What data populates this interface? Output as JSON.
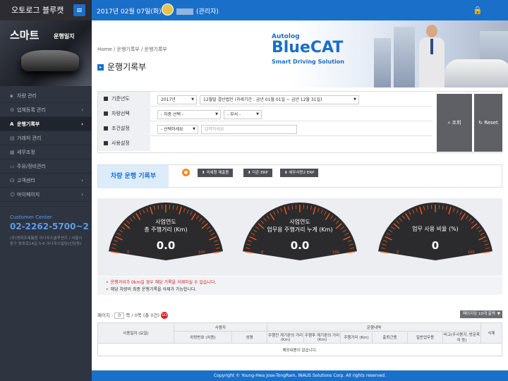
{
  "header": {
    "app_title": "오토로그 블루캣",
    "date": "2017년 02월 07일(화)",
    "user_role": "(관리자)"
  },
  "sidebar": {
    "promo_title": "스마트",
    "promo_subtitle": "운행일지",
    "items": [
      {
        "label": "차량 관리",
        "icon": "car-icon",
        "active": false,
        "chevron": ""
      },
      {
        "label": "업체등록 관리",
        "icon": "gear-icon",
        "active": false,
        "chevron": "›"
      },
      {
        "label": "운행기록부",
        "icon": "a-icon",
        "active": true,
        "chevron": "›"
      },
      {
        "label": "거래처 관리",
        "icon": "document-icon",
        "active": false,
        "chevron": ""
      },
      {
        "label": "세무조정",
        "icon": "calculator-icon",
        "active": false,
        "chevron": ""
      },
      {
        "label": "주유/정비관리",
        "icon": "wallet-icon",
        "active": false,
        "chevron": ""
      },
      {
        "label": "고객센터",
        "icon": "headset-icon",
        "active": false,
        "chevron": "›"
      },
      {
        "label": "마이페이지",
        "icon": "person-icon",
        "active": false,
        "chevron": "›"
      }
    ],
    "customer_center_label": "Customer Center",
    "customer_center_phone": "02-2262-5700~2",
    "address": "(주)영화조세통람 이나우스솔루션즈 / 서울시 중구 동호로14길 5-6 이나우스빌딩(신당동)"
  },
  "breadcrumb": {
    "home": "Home",
    "level1": "운행기록부",
    "level2": "운행기록부",
    "sep": "/"
  },
  "page_title": "운행기록부",
  "banner": {
    "logo_top": "Autolog",
    "logo_main": "BlueCAT",
    "logo_sub": "Smart Driving Solution"
  },
  "filter": {
    "rows": [
      {
        "label": "기준년도"
      },
      {
        "label": "차량선택"
      },
      {
        "label": "조건설정"
      },
      {
        "label": "사용설정"
      }
    ],
    "year": "2017년",
    "period": "12월말 결산법인 (과세기간 : 금년 01월 01일 ~ 금년 12월 31일)",
    "vehicle_select": "- 차종 선택 -",
    "dept_select": "- 부서 -",
    "condition_select": "- 선택하세요",
    "condition_placeholder": "입력하세요",
    "search_label": "조회",
    "reset_label": "Reset"
  },
  "section": {
    "title": "차량 운행 기록부",
    "buttons": [
      {
        "label": "국세청 제출용"
      },
      {
        "label": "더존 ERP"
      },
      {
        "label": "세무사랑2 ERP"
      }
    ]
  },
  "gauges": [
    {
      "line1": "사업연도",
      "line2": "총 주행거리 (Km)",
      "value": "0.0",
      "min": "0",
      "max": "100"
    },
    {
      "line1": "사업연도",
      "line2": "업무용 주행거리 누계 (Km)",
      "value": "0.0",
      "min": "0",
      "max": "100"
    },
    {
      "line1": "",
      "line2": "업무 사용 비율 (%)",
      "value": "0",
      "min": "0",
      "max": "100"
    }
  ],
  "notices": {
    "first": "운행거리가 0km일 경우 해당 기록을 삭제하실 수 있습니다.",
    "second": "해당 차량의 최종 운행기록을 삭제가 가능합니다."
  },
  "pager": {
    "label": "페이지",
    "current": "0",
    "info": "쪽 / 0쪽 (총 0건)",
    "go": "GO",
    "per_page": "페이지당 10개 출력"
  },
  "table": {
    "group_user": "사용자",
    "group_run": "운행내역",
    "col_date": "사용일자 (요일)",
    "col_dept": "차량번호 (차종)",
    "col_name": "성명",
    "col_before": "주행전 계기판의 거리 (Km)",
    "col_after": "주행후 계기판의 거리 (Km)",
    "col_distance": "주행거리 (Km)",
    "col_commute": "출퇴근용",
    "col_business": "일반업무용",
    "col_note": "비고(주사용지, 방문목적 등)",
    "col_delete": "삭제",
    "empty": "해당내용이 없습니다."
  },
  "footer": "Copyright © Young-Hwa Jose-TongRam, INAUS Solutions Corp. All rights reserved.",
  "colors": {
    "accent": "#1a6fc9",
    "gauge_red": "#f05a1e",
    "sidebar": "#2e3440"
  }
}
